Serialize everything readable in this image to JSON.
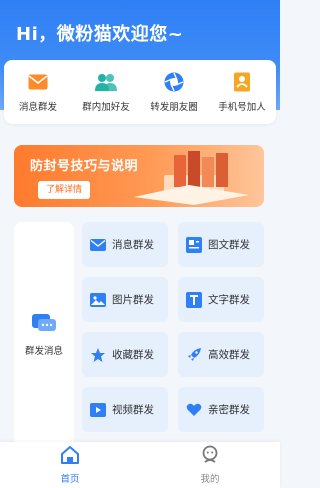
{
  "header": {
    "greeting": "Hi，微粉猫欢迎您~"
  },
  "quick_actions": [
    {
      "label": "消息群发",
      "icon": "envelope-icon",
      "color": "#ff8a2a"
    },
    {
      "label": "群内加好友",
      "icon": "group-people-icon",
      "color": "#21b3a6"
    },
    {
      "label": "转发朋友圈",
      "icon": "shutter-circle-icon",
      "color": "#2f7ff5"
    },
    {
      "label": "手机号加人",
      "icon": "contact-book-icon",
      "color": "#f5a623"
    }
  ],
  "banner": {
    "title": "防封号技巧与说明",
    "button": "了解详情"
  },
  "side_panel": {
    "label": "群发消息",
    "icon": "chat-bubbles-icon"
  },
  "features": [
    {
      "label": "消息群发",
      "icon": "envelope-icon"
    },
    {
      "label": "图文群发",
      "icon": "image-text-icon"
    },
    {
      "label": "图片群发",
      "icon": "picture-icon"
    },
    {
      "label": "文字群发",
      "icon": "text-t-icon"
    },
    {
      "label": "收藏群发",
      "icon": "star-icon"
    },
    {
      "label": "高效群发",
      "icon": "rocket-icon"
    },
    {
      "label": "视频群发",
      "icon": "video-play-icon"
    },
    {
      "label": "亲密群发",
      "icon": "heart-icon"
    }
  ],
  "tabbar": [
    {
      "label": "首页",
      "icon": "home-icon",
      "active": true
    },
    {
      "label": "我的",
      "icon": "profile-icon",
      "active": false
    }
  ],
  "colors": {
    "primary": "#2f7ff5",
    "banner_orange": "#ff7a2d",
    "cell_bg": "#e6f0fd"
  }
}
